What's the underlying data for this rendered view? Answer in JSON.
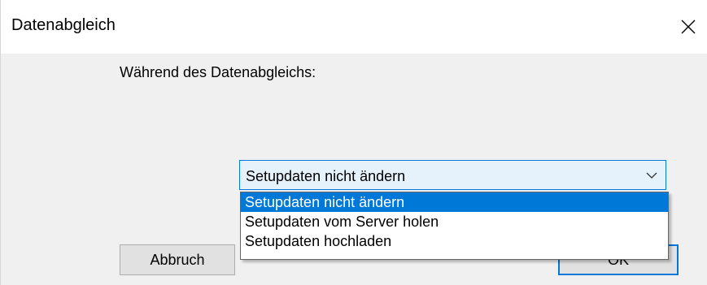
{
  "window": {
    "title": "Datenabgleich",
    "close_icon": "close-icon"
  },
  "dialog": {
    "prompt": "Während des Datenabgleichs:",
    "combo": {
      "selected": "Setupdaten nicht ändern",
      "arrow_icon": "chevron-down-icon"
    },
    "dropdown_options": [
      "Setupdaten nicht ändern",
      "Setupdaten vom Server holen",
      "Setupdaten hochladen"
    ],
    "selected_index": 0,
    "buttons": {
      "cancel": "Abbruch",
      "ok": "OK"
    }
  },
  "colors": {
    "accent": "#0078d7",
    "background": "#f0f0f0",
    "combo_bg": "#e5f1fb"
  }
}
